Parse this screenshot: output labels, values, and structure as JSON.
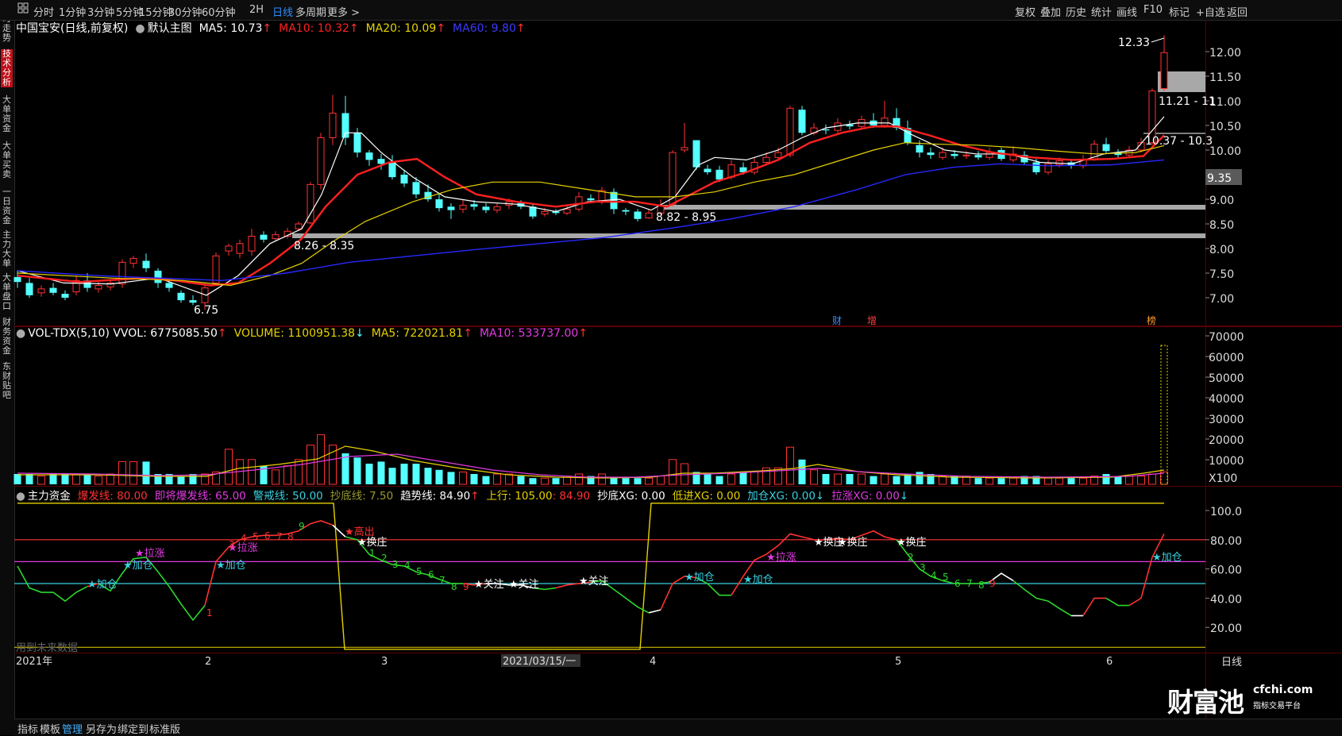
{
  "toolbar": {
    "home_icon": "grid-icon",
    "periods": [
      "分时",
      "1分钟",
      "3分钟",
      "5分钟",
      "15分钟",
      "30分钟",
      "60分钟",
      "2H",
      "日线",
      "多周期",
      "更多"
    ],
    "active_period": "日线",
    "right_tools": [
      "复权",
      "叠加",
      "历史",
      "统计",
      "画线",
      "F10",
      "标记",
      "+自选",
      "返回"
    ]
  },
  "sidebar": {
    "items": [
      "分时走势",
      "技术分析",
      "大单资金",
      "大单买卖",
      "一日资金",
      "主力大单",
      "大单盘口",
      "财务资金",
      "东财贴吧"
    ],
    "active": "技术分析"
  },
  "price_panel": {
    "title": "中国宝安(日线,前复权)",
    "template": "默认主图",
    "ma5": "MA5: 10.73",
    "ma10": "MA10: 10.32",
    "ma20": "MA20: 10.09",
    "ma60": "MA60: 9.80",
    "up_arrow": "↑",
    "y_ticks": [
      "12.00",
      "11.50",
      "11.00",
      "10.50",
      "10.00",
      "9.50",
      "9.00",
      "8.50",
      "8.00",
      "7.50",
      "7.00"
    ],
    "current_price": "9.35",
    "high_label": "12.33",
    "low_label": "6.75",
    "zone1": "8.26 - 8.35",
    "zone2": "8.82 - 8.95",
    "zone3": "11.21 - 11",
    "zone4": "10.37 - 10.3",
    "event_marks": [
      "财",
      "增",
      "榜"
    ]
  },
  "volume_panel": {
    "title": "VOL-TDX(5,10) VVOL: 6775085.50",
    "volume": "VOLUME: 1100951.38",
    "ma5": "MA5: 722021.81",
    "ma10": "MA10: 533737.00",
    "down_arrow": "↓",
    "up_arrow": "↑",
    "y_ticks": [
      "70000",
      "60000",
      "50000",
      "40000",
      "30000",
      "20000",
      "10000"
    ],
    "unit": "X100"
  },
  "indicator_panel": {
    "name": "主力资金",
    "boom": "爆发线: 80.00",
    "near_boom": "即将爆发线: 65.00",
    "alert": "警戒线: 50.00",
    "bottom": "抄底线: 7.50",
    "trend": "趋势线: 84.90",
    "up_arrow": "↑",
    "upward": "上行: 105.00",
    "upward_val": ": 84.90",
    "xg_bottom": "抄底XG: 0.00",
    "xg_low": "低进XG: 0.00",
    "xg_add": "加仓XG: 0.00",
    "xg_pull": "拉涨XG: 0.00",
    "down_arrow": "↓",
    "y_ticks": [
      "100.0",
      "80.00",
      "60.00",
      "40.00",
      "20.00"
    ],
    "future_note": "用到未来数据",
    "signals": {
      "add": "★加仓",
      "pull": "★拉涨",
      "high": "★高出",
      "swap": "★换庄",
      "follow": "★关注"
    }
  },
  "x_axis": {
    "labels": [
      "2021年",
      "2",
      "3",
      "2021/03/15/一",
      "4",
      "5",
      "6"
    ],
    "right_label": "日线"
  },
  "watermark": {
    "brand": "财富池",
    "site": "cfchi.com",
    "slogan": "指标交易平台"
  },
  "bottombar": {
    "items": [
      "指标",
      "模板",
      "管理",
      "另存为",
      "绑定到",
      "标准版"
    ],
    "active": "管理"
  },
  "colors": {
    "up": "#ff3232",
    "down": "#54ffff",
    "ma5": "#ffffff",
    "ma10": "#ff2020",
    "ma20": "#e6d200",
    "ma60": "#2828ff",
    "magenta": "#e23ae2",
    "cyan": "#39d0e0",
    "accent_blue": "#2f8cff"
  }
}
